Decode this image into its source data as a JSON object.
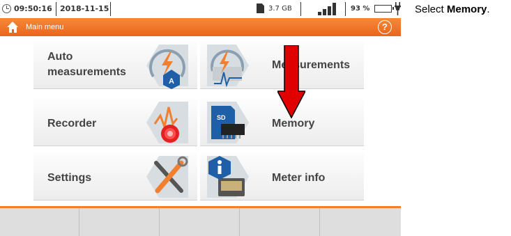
{
  "status_bar": {
    "time": "09:50:16",
    "date": "2018-11-15",
    "storage": "3.7 GB",
    "battery_percent": "93 %"
  },
  "title_bar": {
    "title": "Main menu",
    "help_label": "?"
  },
  "menu": {
    "auto_measurements_line1": "Auto",
    "auto_measurements_line2": "measurements",
    "measurements": "Measurements",
    "recorder": "Recorder",
    "memory": "Memory",
    "settings": "Settings",
    "meter_info": "Meter info"
  },
  "instruction": {
    "prefix": "Select ",
    "emphasis": "Memory",
    "suffix": "."
  },
  "colors": {
    "accent": "#f07f30",
    "arrow": "#e00000"
  }
}
